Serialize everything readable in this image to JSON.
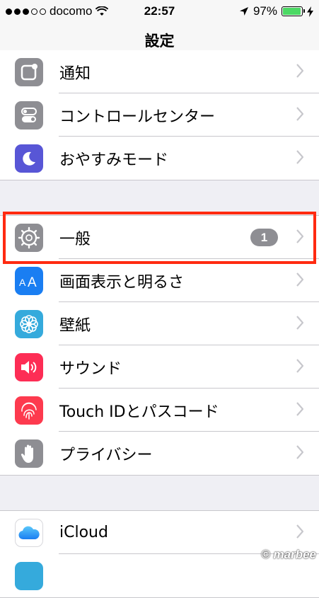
{
  "status": {
    "carrier": "docomo",
    "time": "22:57",
    "battery": "97%",
    "battery_level": 0.97
  },
  "nav": {
    "title": "設定"
  },
  "groups": [
    {
      "items": [
        {
          "label": "通知",
          "icon": "notifications-icon",
          "color": "#8e8e93"
        },
        {
          "label": "コントロールセンター",
          "icon": "control-center-icon",
          "color": "#8e8e93"
        },
        {
          "label": "おやすみモード",
          "icon": "moon-icon",
          "color": "#5856d6"
        }
      ]
    },
    {
      "items": [
        {
          "label": "一般",
          "icon": "gear-icon",
          "color": "#8e8e93",
          "badge": "1"
        },
        {
          "label": "画面表示と明るさ",
          "icon": "display-text-size-icon",
          "color": "#1a7ef2"
        },
        {
          "label": "壁紙",
          "icon": "wallpaper-flower-icon",
          "color": "#35aadc"
        },
        {
          "label": "サウンド",
          "icon": "speaker-icon",
          "color": "#fd2d55"
        },
        {
          "label": "Touch IDとパスコード",
          "icon": "fingerprint-icon",
          "color": "#fd3a4e"
        },
        {
          "label": "プライバシー",
          "icon": "hand-icon",
          "color": "#8e8e93"
        }
      ]
    },
    {
      "items": [
        {
          "label": "iCloud",
          "icon": "cloud-icon",
          "color": "#ffffff"
        }
      ]
    }
  ],
  "highlight_color": "#ff2a10",
  "watermark": "© marbee"
}
